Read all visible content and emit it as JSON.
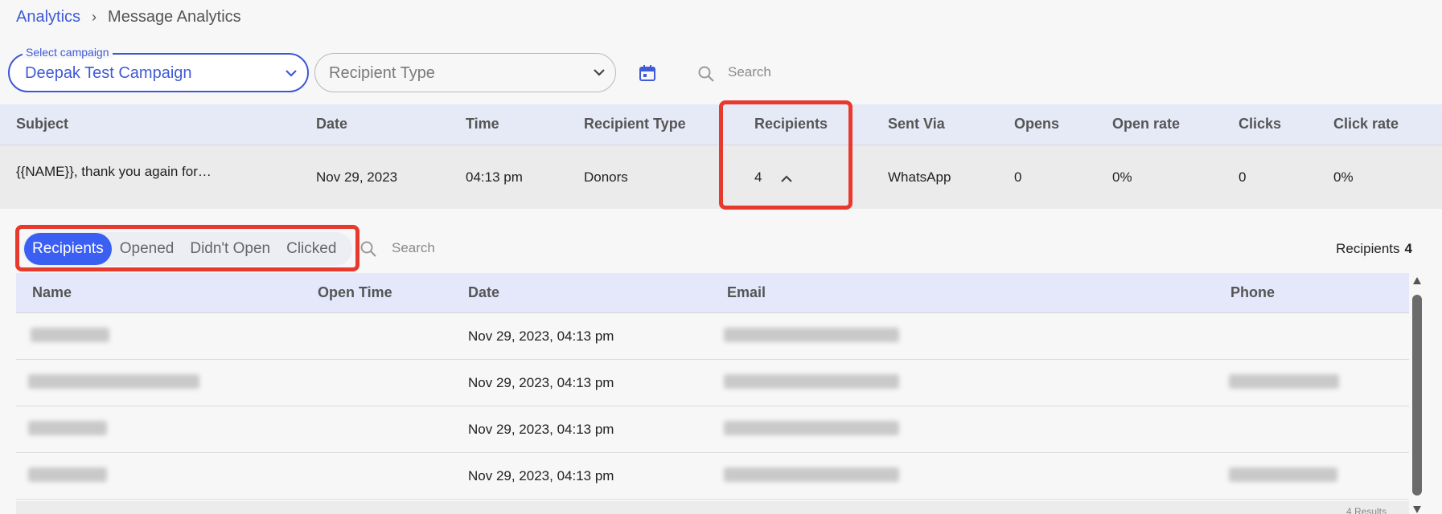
{
  "breadcrumb": {
    "root": "Analytics",
    "separator": "›",
    "current": "Message Analytics"
  },
  "filters": {
    "campaign_label": "Select campaign",
    "campaign_value": "Deepak Test Campaign",
    "recipient_type_placeholder": "Recipient Type",
    "search_placeholder": "Search"
  },
  "main_table": {
    "headers": [
      "Subject",
      "Date",
      "Time",
      "Recipient Type",
      "Recipients",
      "Sent Via",
      "Opens",
      "Open rate",
      "Clicks",
      "Click rate"
    ],
    "row": {
      "subject": "{{NAME}}, thank you again for…",
      "date": "Nov 29, 2023",
      "time": "04:13 pm",
      "recipient_type": "Donors",
      "recipients": "4",
      "sent_via": "WhatsApp",
      "opens": "0",
      "open_rate": "0%",
      "clicks": "0",
      "click_rate": "0%"
    }
  },
  "sub_tabs": [
    "Recipients",
    "Opened",
    "Didn't Open",
    "Clicked"
  ],
  "sub_search_placeholder": "Search",
  "recipients_summary": {
    "label": "Recipients",
    "count": "4"
  },
  "sub_table": {
    "headers": [
      "Name",
      "Open Time",
      "Date",
      "Email",
      "Phone"
    ],
    "rows": [
      {
        "date": "Nov 29, 2023, 04:13 pm"
      },
      {
        "date": "Nov 29, 2023, 04:13 pm"
      },
      {
        "date": "Nov 29, 2023, 04:13 pm"
      },
      {
        "date": "Nov 29, 2023, 04:13 pm"
      }
    ],
    "results": "4 Results"
  },
  "colors": {
    "accent": "#3f5bd6",
    "active_tab": "#3b5ff2",
    "highlight": "#e8392f",
    "header_bg": "#e6eaf7"
  }
}
